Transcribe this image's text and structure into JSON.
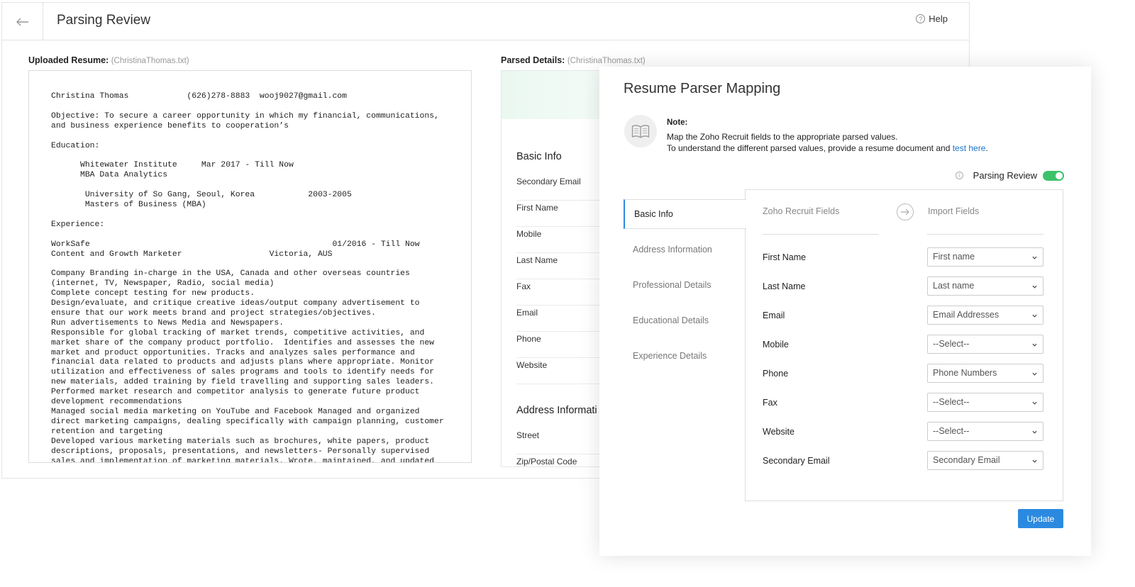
{
  "header": {
    "title": "Parsing Review",
    "help_label": "Help"
  },
  "uploaded": {
    "label": "Uploaded Resume:",
    "file": "(ChristinaThomas.txt)"
  },
  "parsed": {
    "label": "Parsed Details:",
    "file": "(ChristinaThomas.txt)"
  },
  "resume_text": "Christina Thomas            (626)278-8883  wooj9027@gmail.com\n\nObjective: To secure a career opportunity in which my financial, communications,\nand business experience benefits to cooperation’s\n\nEducation:\n\n      Whitewater Institute     Mar 2017 - Till Now\n      MBA Data Analytics\n\n       University of So Gang, Seoul, Korea           2003-2005\n       Masters of Business (MBA)\n\nExperience:\n\nWorkSafe                                                  01/2016 - Till Now\nContent and Growth Marketer                  Victoria, AUS\n\nCompany Branding in-charge in the USA, Canada and other overseas countries\n(internet, TV, Newspaper, Radio, social media)\nComplete concept testing for new products.\nDesign/evaluate, and critique creative ideas/output company advertisement to\nensure that our work meets brand and project strategies/objectives.\nRun advertisements to News Media and Newspapers.\nResponsible for global tracking of market trends, competitive activities, and\nmarket share of the company product portfolio.  Identifies and assesses the new\nmarket and product opportunities. Tracks and analyzes sales performance and\nfinancial data related to products and adjusts plans where appropriate. Monitor\nutilization and effectiveness of sales programs and tools to identify needs for\nnew materials, added training by field travelling and supporting sales leaders.\nPerformed market research and competitor analysis to generate future product\ndevelopment recommendations\nManaged social media marketing on YouTube and Facebook Managed and organized\ndirect marketing campaigns, dealing specifically with campaign planning, customer\nretention and targeting\nDeveloped various marketing materials such as brochures, white papers, product\ndescriptions, proposals, presentations, and newsletters- Personally supervised\nsales and implementation of marketing materials. Wrote, maintained, and updated",
  "parsed_details": {
    "basic_heading": "Basic Info",
    "basic_rows": [
      "Secondary Email",
      "First Name",
      "Mobile",
      "Last Name",
      "Fax",
      "Email",
      "Phone",
      "Website"
    ],
    "address_heading": "Address Informati",
    "address_rows": [
      "Street",
      "Zip/Postal Code"
    ]
  },
  "modal": {
    "title": "Resume Parser Mapping",
    "note_title": "Note:",
    "note_line1": "Map the Zoho Recruit fields to the appropriate parsed values.",
    "note_line2": "To understand the different parsed values, provide a resume document and ",
    "note_link": "test here",
    "note_end": ".",
    "parsing_review_label": "Parsing Review",
    "parsing_review_on": true,
    "tabs": [
      "Basic Info",
      "Address Information",
      "Professional Details",
      "Educational Details",
      "Experience Details"
    ],
    "active_tab": "Basic Info",
    "col_zoho": "Zoho Recruit Fields",
    "col_import": "Import Fields",
    "fields": [
      {
        "label": "First Name",
        "value": "First name"
      },
      {
        "label": "Last Name",
        "value": "Last name"
      },
      {
        "label": "Email",
        "value": "Email Addresses"
      },
      {
        "label": "Mobile",
        "value": "--Select--"
      },
      {
        "label": "Phone",
        "value": "Phone Numbers"
      },
      {
        "label": "Fax",
        "value": "--Select--"
      },
      {
        "label": "Website",
        "value": "--Select--"
      },
      {
        "label": "Secondary Email",
        "value": "Secondary Email"
      }
    ],
    "update_label": "Update"
  },
  "colors": {
    "accent": "#2b8ae0",
    "toggle": "#3cc26b",
    "link": "#1a73c8"
  },
  "icons": [
    "back-arrow-icon",
    "help-icon",
    "book-icon",
    "info-icon",
    "arrow-right-icon",
    "chevron-down-icon"
  ]
}
